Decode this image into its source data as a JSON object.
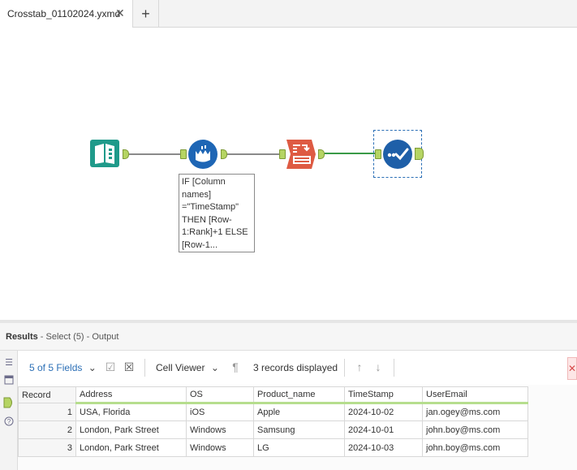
{
  "tab": {
    "title": "Crosstab_01102024.yxmd",
    "close": "✕",
    "new": "+"
  },
  "annotation": "IF [Column names] =\"TimeStamp\" THEN [Row-1:Rank]+1 ELSE [Row-1...",
  "colors": {
    "input_tool": "#1f9a8a",
    "formula_tool": "#1e66b5",
    "crosstab_tool": "#de5b43",
    "select_tool": "#1e5fa8",
    "anchor": "#b5d463",
    "connection_active": "#3a9a48",
    "connection": "#8a8a8a"
  },
  "results": {
    "title": "Results",
    "subtitle": " - Select (5) - Output"
  },
  "toolbar": {
    "fields": "5 of 5 Fields",
    "viewer": "Cell Viewer",
    "records": "3 records displayed"
  },
  "table": {
    "columns": [
      "Record",
      "Address",
      "OS",
      "Product_name",
      "TimeStamp",
      "UserEmail"
    ],
    "rows": [
      [
        "1",
        "USA, Florida",
        "iOS",
        "Apple",
        "2024-10-02",
        "jan.ogey@ms.com"
      ],
      [
        "2",
        "London, Park Street",
        "Windows",
        "Samsung",
        "2024-10-01",
        "john.boy@ms.com"
      ],
      [
        "3",
        "London, Park Street",
        "Windows",
        "LG",
        "2024-10-03",
        "john.boy@ms.com"
      ]
    ]
  }
}
